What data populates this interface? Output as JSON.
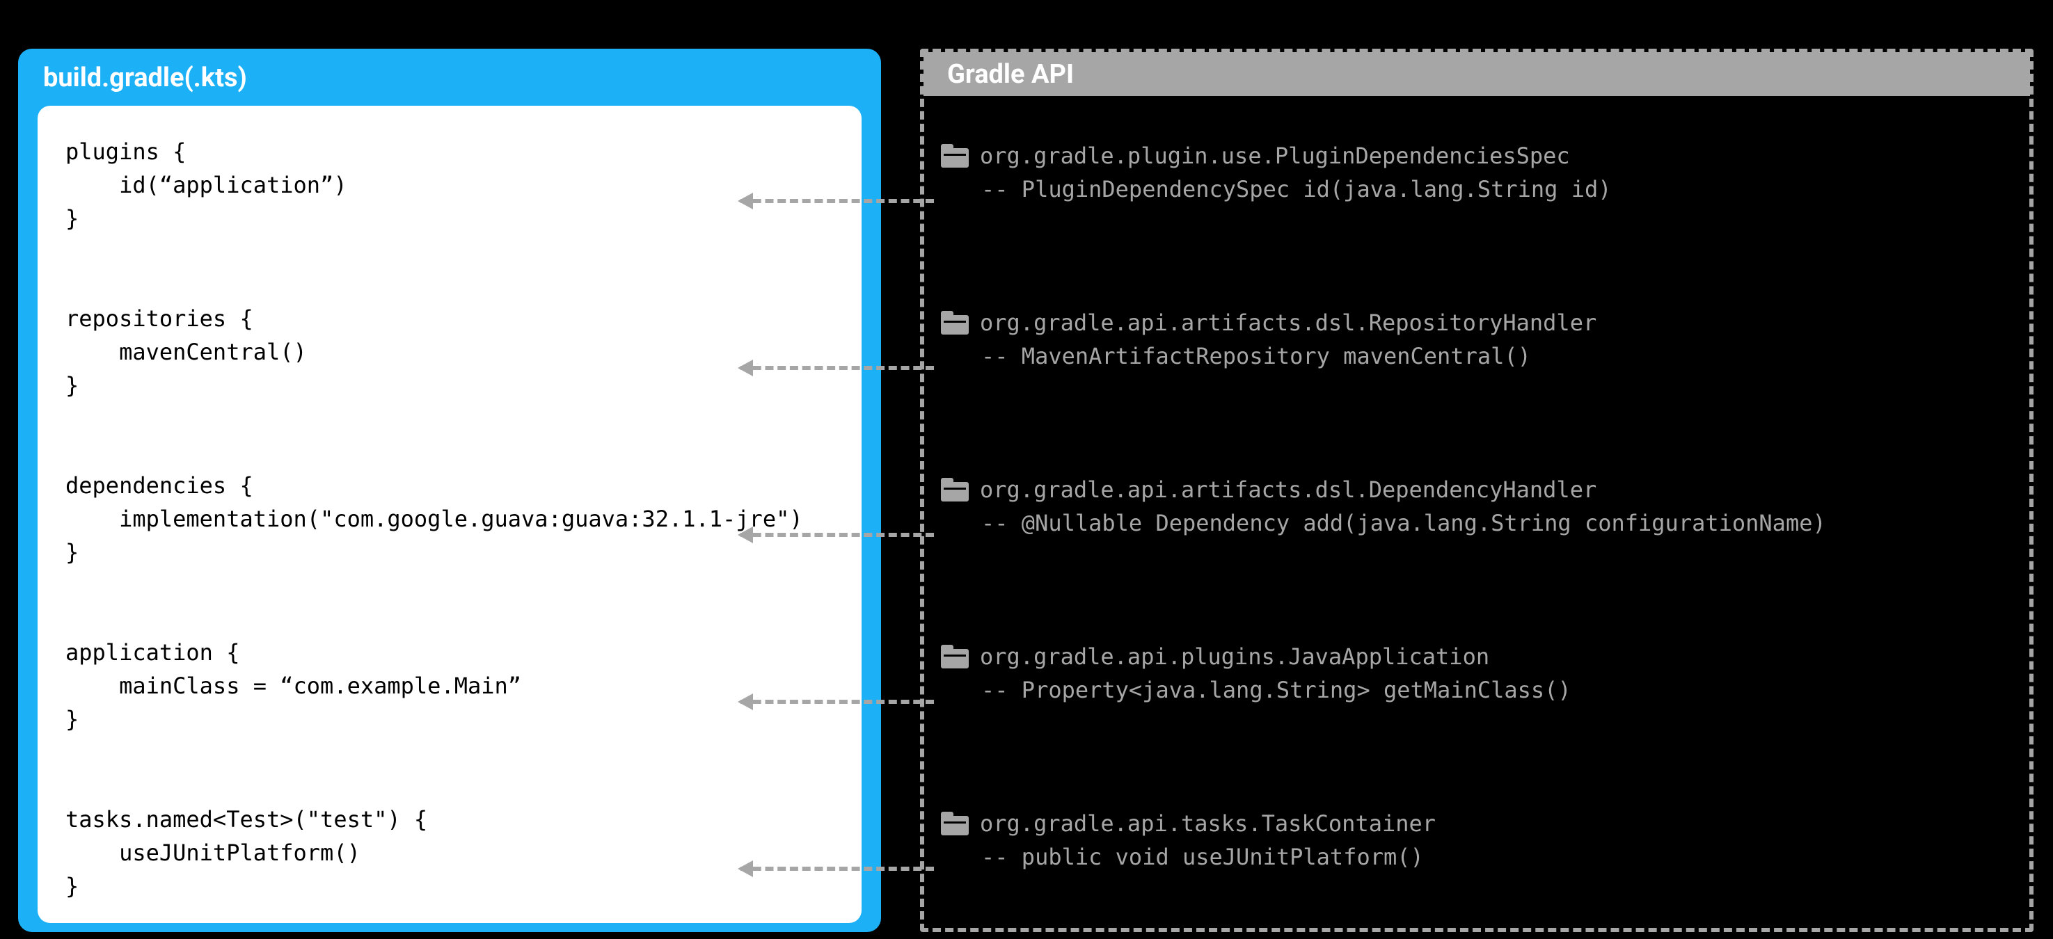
{
  "left": {
    "title": "build.gradle(.kts)",
    "code": "plugins {\n    id(“application”)\n}\n\n\nrepositories {\n    mavenCentral()\n}\n\n\ndependencies {\n    implementation(\"com.google.guava:guava:32.1.1-jre\")\n}\n\n\napplication {\n    mainClass = “com.example.Main”\n}\n\n\ntasks.named<Test>(\"test\") {\n    useJUnitPlatform()\n}"
  },
  "right": {
    "title": "Gradle API",
    "entries": [
      {
        "class": "org.gradle.plugin.use.PluginDependenciesSpec",
        "method": "-- PluginDependencySpec id(java.lang.String id)"
      },
      {
        "class": "org.gradle.api.artifacts.dsl.RepositoryHandler",
        "method": "-- MavenArtifactRepository mavenCentral()"
      },
      {
        "class": "org.gradle.api.artifacts.dsl.DependencyHandler",
        "method": "-- @Nullable Dependency add(java.lang.String configurationName)"
      },
      {
        "class": "org.gradle.api.plugins.JavaApplication",
        "method": "-- Property<java.lang.String> getMainClass()"
      },
      {
        "class": "org.gradle.api.tasks.TaskContainer",
        "method": "-- public void useJUnitPlatform()"
      }
    ]
  },
  "layout": {
    "entryTops": [
      24,
      264,
      504,
      744,
      984
    ],
    "arrowTops": [
      216,
      456,
      696,
      936,
      1176
    ],
    "arrowLeft": 1038,
    "arrowWidth": 278
  }
}
